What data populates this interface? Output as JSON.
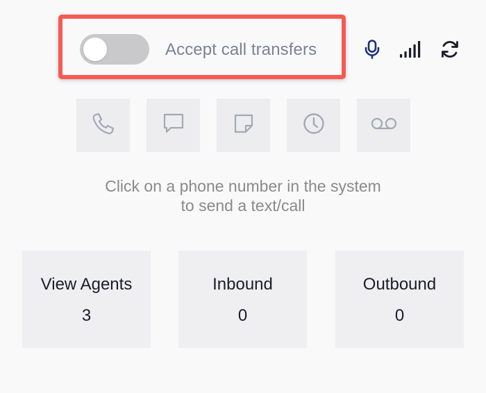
{
  "call_transfer": {
    "label": "Accept call transfers",
    "enabled": false
  },
  "toolbar_icons": [
    "microphone-icon",
    "signal-strength-icon",
    "refresh-icon"
  ],
  "actions": [
    {
      "icon": "phone-icon"
    },
    {
      "icon": "chat-icon"
    },
    {
      "icon": "note-icon"
    },
    {
      "icon": "clock-icon"
    },
    {
      "icon": "voicemail-icon"
    }
  ],
  "hint": {
    "line1": "Click on a phone number in the system",
    "line2": "to send a text/call"
  },
  "stats": [
    {
      "label": "View Agents",
      "value": "3"
    },
    {
      "label": "Inbound",
      "value": "0"
    },
    {
      "label": "Outbound",
      "value": "0"
    }
  ],
  "colors": {
    "highlight": "#f65a52",
    "toggle_off": "#c9c9cb",
    "tile_bg": "#ededf0",
    "icon_disabled": "#a3a8b4",
    "icon_active": "#1b2a4a"
  }
}
